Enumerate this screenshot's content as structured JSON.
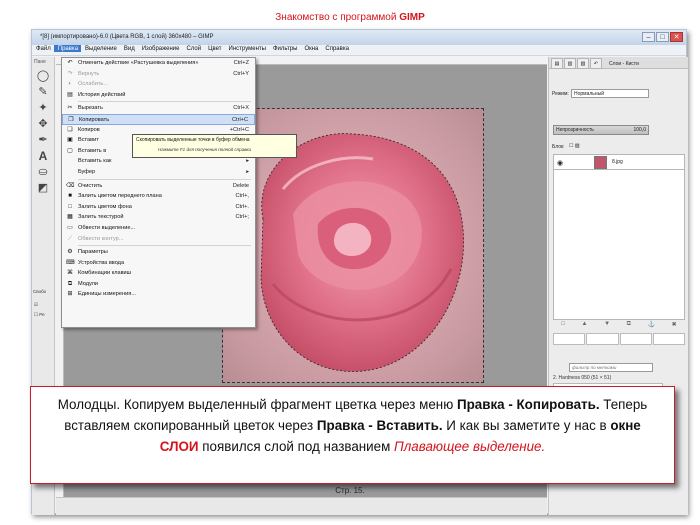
{
  "slide": {
    "title_plain": "Знакомство с программой ",
    "title_bold": "GIMP",
    "footer": "Стр. 15."
  },
  "window": {
    "title": "*[8] (импортировано)-6.0 (Цвета RGB, 1 слой) 360x480 – GIMP",
    "menubar": [
      "Файл",
      "Правка",
      "Выделение",
      "Вид",
      "Изображение",
      "Слой",
      "Цвет",
      "Инструменты",
      "Фильтры",
      "Окна",
      "Справка"
    ],
    "active_menu": "Правка"
  },
  "toolbox": {
    "label": "Пане",
    "options_label": "Свобо",
    "options_item": "Ре"
  },
  "edit_menu": {
    "items": [
      {
        "icon": "undo-icon",
        "glyph": "↶",
        "label": "Отменить действие «Растушевка выделения»",
        "shortcut": "Ctrl+Z",
        "disabled": false
      },
      {
        "icon": "redo-icon",
        "glyph": "↷",
        "label": "Вернуть",
        "shortcut": "Ctrl+Y",
        "disabled": true
      },
      {
        "icon": "fade-icon",
        "glyph": "◐",
        "label": "Ослабить...",
        "shortcut": "",
        "disabled": true
      },
      {
        "icon": "history-icon",
        "glyph": "▤",
        "label": "История действий",
        "shortcut": "",
        "disabled": false
      },
      {
        "sep": true
      },
      {
        "icon": "cut-icon",
        "glyph": "✂",
        "label": "Вырезать",
        "shortcut": "Ctrl+X",
        "disabled": false
      },
      {
        "icon": "copy-icon",
        "glyph": "❐",
        "label": "Копировать",
        "shortcut": "Ctrl+C",
        "disabled": false,
        "highlight": true
      },
      {
        "icon": "copy-visible-icon",
        "glyph": "❏",
        "label": "Копиров",
        "shortcut": "+Ctrl+C",
        "disabled": false
      },
      {
        "icon": "paste-icon",
        "glyph": "▣",
        "label": "Вставит",
        "shortcut": "Ctrl+V",
        "disabled": false
      },
      {
        "icon": "paste-into-icon",
        "glyph": "▢",
        "label": "Вставить в",
        "shortcut": "",
        "disabled": false
      },
      {
        "icon": "",
        "glyph": "",
        "label": "Вставить как",
        "shortcut": "▸",
        "disabled": false
      },
      {
        "icon": "",
        "glyph": "",
        "label": "Буфер",
        "shortcut": "▸",
        "disabled": false
      },
      {
        "sep": true
      },
      {
        "icon": "clear-icon",
        "glyph": "⌫",
        "label": "Очистить",
        "shortcut": "Delete",
        "disabled": false
      },
      {
        "icon": "fill-fg-icon",
        "glyph": "■",
        "label": "Залить цветом переднего плана",
        "shortcut": "Ctrl+,",
        "disabled": false
      },
      {
        "icon": "fill-bg-icon",
        "glyph": "□",
        "label": "Залить цветом фона",
        "shortcut": "Ctrl+.",
        "disabled": false
      },
      {
        "icon": "fill-pattern-icon",
        "glyph": "▦",
        "label": "Залить текстурой",
        "shortcut": "Ctrl+;",
        "disabled": false
      },
      {
        "icon": "stroke-selection-icon",
        "glyph": "▭",
        "label": "Обвести выделение...",
        "shortcut": "",
        "disabled": false
      },
      {
        "icon": "stroke-path-icon",
        "glyph": "⟋",
        "label": "Обвести контур...",
        "shortcut": "",
        "disabled": true
      },
      {
        "sep": true
      },
      {
        "icon": "preferences-icon",
        "glyph": "⚙",
        "label": "Параметры",
        "shortcut": "",
        "disabled": false
      },
      {
        "icon": "input-devices-icon",
        "glyph": "⌨",
        "label": "Устройства ввода",
        "shortcut": "",
        "disabled": false
      },
      {
        "icon": "keyboard-shortcuts-icon",
        "glyph": "⌘",
        "label": "Комбинации клавиш",
        "shortcut": "",
        "disabled": false
      },
      {
        "icon": "modules-icon",
        "glyph": "⧉",
        "label": "Модули",
        "shortcut": "",
        "disabled": false
      },
      {
        "icon": "units-icon",
        "glyph": "⊞",
        "label": "Единицы измерения...",
        "shortcut": "",
        "disabled": false
      }
    ]
  },
  "tooltip": {
    "text": "Скопировать выделенные точки в буфер обмена",
    "hint": "Нажмите F1 для получения полной справки"
  },
  "layers_panel": {
    "tab": "Слои - Кисти",
    "mode_label": "Режим:",
    "mode_value": "Нормальный",
    "opacity_label": "Непрозрачность",
    "opacity_value": "100,0",
    "lock_label": "Блок:",
    "layer_name": "8.jpg",
    "brush_filter": "фильтр по метками",
    "brush_name": "2. Hardness 050 (51 × 51)"
  },
  "callout": {
    "p1": "Молодцы. Копируем выделенный фрагмент цветка через меню ",
    "b1": "Правка - Копировать.",
    "p2": " Теперь вставляем скопированный цветок через ",
    "b2": "Правка - Вставить.",
    "p3": " И как вы заметите у нас в ",
    "b3": "окне ",
    "r1": "СЛОИ",
    "p4": " появился слой под названием ",
    "ri": "Плавающее выделение."
  },
  "colors": {
    "accent_red": "#d4141c",
    "menu_highlight": "#cfe0f6",
    "selected_menubar": "#3d78c9"
  }
}
